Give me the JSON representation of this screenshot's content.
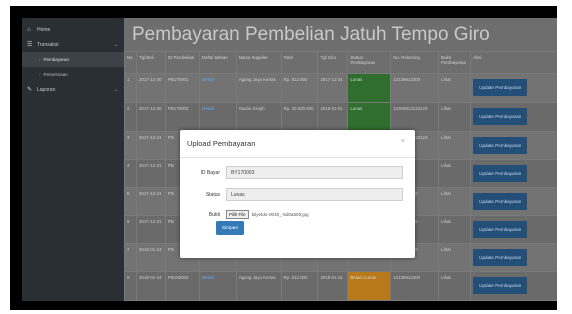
{
  "sidebar": {
    "home": "Home",
    "transaksi": "Transaksi",
    "pembayaran": "Pembayaran",
    "penerimaan": "Penerimaan",
    "laporan": "Laporan"
  },
  "page_title": "Pembayaran Pembelian Jatuh Tempo Giro",
  "table": {
    "headers": [
      "No",
      "Tgl Beli",
      "ID Pembelian",
      "Daftar Beban",
      "Nama Supplier",
      "Total",
      "Tgl Giro",
      "Status Pembayaran",
      "No. Rekening",
      "Bukti Pembayaran",
      "Aksi"
    ],
    "rows": [
      [
        "1",
        "2017-12-30",
        "PB170001",
        "Detail",
        "Agung Jaya Kertas",
        "Rp. 812.000",
        "2017-12-31",
        "Lunas",
        "12139912300",
        "Lihat",
        "Update Pembayaran"
      ],
      [
        "2",
        "2017-12-30",
        "PB170002",
        "Detail",
        "Studio Graph",
        "Rp. 10.000.000",
        "2018-01-01",
        "Lunas",
        "12309812123123",
        "Lihat",
        "Update Pembayaran"
      ],
      [
        "3",
        "2017-12-31",
        "PB",
        "",
        "",
        "",
        "",
        "",
        "12309812123123",
        "Lihat",
        "Update Pembayaran"
      ],
      [
        "4",
        "2017-12-31",
        "PB",
        "",
        "",
        "",
        "",
        "",
        "3123131",
        "Lihat",
        "Update Pembayaran"
      ],
      [
        "5",
        "2017-12-31",
        "PB",
        "",
        "",
        "",
        "",
        "",
        "7213912300",
        "Lihat",
        "Update Pembayaran"
      ],
      [
        "6",
        "2017-12-31",
        "PB",
        "",
        "",
        "",
        "",
        "",
        "7213912300",
        "Lihat",
        "Update Pembayaran"
      ],
      [
        "7",
        "2018-01-24",
        "PB",
        "",
        "Kertas",
        "",
        "18",
        "",
        "7213912300",
        "Lihat",
        "Update Pembayaran"
      ],
      [
        "8",
        "2018-01-24",
        "PB180002",
        "Detail",
        "Agung Jaya Kertas",
        "Rp. 812.000",
        "2018-01-31",
        "Belum Lunas",
        "12139912300",
        "Lihat",
        "Update Pembayaran"
      ]
    ]
  },
  "modal": {
    "title": "Upload Pembayaran",
    "close": "×",
    "id_bayar_label": "ID Bayar",
    "id_bayar_value": "BY170003",
    "status_label": "Status",
    "status_value": "Lunas",
    "bukti_label": "Bukti",
    "file_button": "Pilih File",
    "file_name": "bilyetdo-0040_-5d0a500.jpg",
    "save_label": "Simpan"
  },
  "colors": {
    "status_green": "#2f6e2f",
    "status_orange": "#b8791b",
    "button_blue": "#234e78",
    "modal_button": "#337ab7"
  }
}
